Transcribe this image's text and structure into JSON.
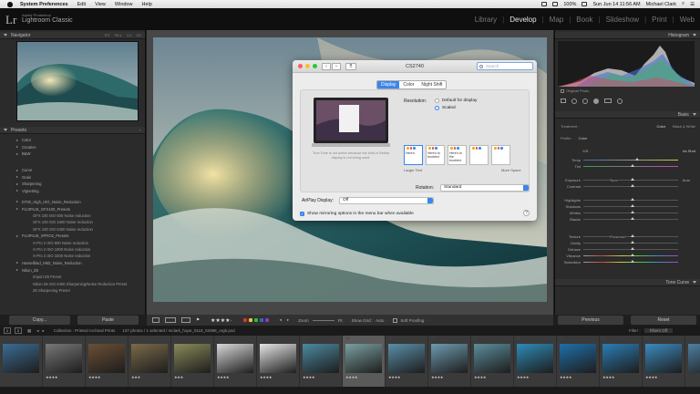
{
  "menubar": {
    "app": "System Preferences",
    "items": [
      "Edit",
      "View",
      "Window",
      "Help"
    ],
    "battery": "100%",
    "datetime": "Sun Jun 14  11:56 AM",
    "user": "Michael Clark"
  },
  "lr": {
    "logo": "Lr",
    "brand_top": "Adobe Photoshop",
    "brand_name": "Lightroom Classic",
    "modules": [
      "Library",
      "Develop",
      "Map",
      "Book",
      "Slideshow",
      "Print",
      "Web"
    ],
    "active_module": "Develop"
  },
  "left": {
    "navigator": "Navigator",
    "nav_zoom": [
      "FIT",
      "FILL",
      "1:1",
      "3:1"
    ],
    "presets": "Presets",
    "preset_groups": [
      "Color",
      "Creative",
      "B&W",
      "Curve",
      "Grain",
      "Sharpening",
      "Vignetting"
    ],
    "preset_items": [
      {
        "label": "D700_High_ISO_Noise_Reduction",
        "indent": false
      },
      {
        "label": "FUJIFILM_GFX100_Presets",
        "indent": false
      },
      {
        "label": "GFX 100 ISO 800 Noise reduction",
        "indent": true
      },
      {
        "label": "GFX 100 ISO 1600 Noise reduction",
        "indent": true
      },
      {
        "label": "GFX 100 ISO 6400 Noise reduction",
        "indent": true
      },
      {
        "label": "FUJIFILM_XPRO2_Presets",
        "indent": false
      },
      {
        "label": "X-Pro 2 ISO 800 Noise reduction",
        "indent": true
      },
      {
        "label": "X-Pro 2 ISO 1600 Noise reduction",
        "indent": true
      },
      {
        "label": "X-Pro 2 ISO 3200 Noise reduction",
        "indent": true
      },
      {
        "label": "Hasselblad_H5D_Noise_Reduction",
        "indent": false
      },
      {
        "label": "Nikon_Z6",
        "indent": false
      },
      {
        "label": "Import Z6 Preset",
        "indent": true
      },
      {
        "label": "Nikon Z6 ISO 6400 Sharpening/Noise Reduction Preset",
        "indent": true
      },
      {
        "label": "Z6 Sharpening Preset",
        "indent": true
      }
    ],
    "copy": "Copy...",
    "paste": "Paste"
  },
  "right": {
    "histogram": "Histogram",
    "original_photo": "Original Photo",
    "basic": "Basic",
    "treatment_label": "Treatment :",
    "treatment_color": "Color",
    "treatment_bw": "Black & White",
    "profile_label": "Profile :",
    "profile_value": "Color",
    "wb_label": "WB :",
    "wb_value": "As Shot",
    "tone": "Tone",
    "auto": "Auto",
    "presence": "Presence",
    "tone_curve": "Tone Curve",
    "previous": "Previous",
    "reset": "Reset",
    "sliders": [
      {
        "label": "Temp",
        "pos": 0.55
      },
      {
        "label": "Tint",
        "pos": 0.5
      },
      {
        "label": "Exposure",
        "pos": 0.5
      },
      {
        "label": "Contrast",
        "pos": 0.5
      },
      {
        "label": "Highlights",
        "pos": 0.5
      },
      {
        "label": "Shadows",
        "pos": 0.5
      },
      {
        "label": "Whites",
        "pos": 0.5
      },
      {
        "label": "Blacks",
        "pos": 0.5
      },
      {
        "label": "Texture",
        "pos": 0.5
      },
      {
        "label": "Clarity",
        "pos": 0.5
      },
      {
        "label": "Dehaze",
        "pos": 0.5
      },
      {
        "label": "Vibrance",
        "pos": 0.5
      },
      {
        "label": "Saturation",
        "pos": 0.5
      }
    ]
  },
  "toolbar": {
    "stars": "★★★★·",
    "zoom": "Zoom",
    "zoom_fit": "Fit",
    "show_grid": "Show Grid :",
    "grid_auto": "Auto",
    "soft_proofing": "Soft Proofing"
  },
  "filmstrip": {
    "collection": "Collection : Printed Archival Prints",
    "count": "137 photos / 1 selected / mclark_hope_0118_02998_orgb.psd",
    "filter": "Filter :",
    "filter_value": "Filters Off",
    "pages": [
      "1",
      "2"
    ],
    "cells": [
      {
        "num": "",
        "color": "#3b6c94",
        "stars": "",
        "sel": false
      },
      {
        "num": "",
        "color": "#787878",
        "stars": "★★★★",
        "sel": false
      },
      {
        "num": "",
        "color": "#6b4f36",
        "stars": "★★★★",
        "sel": false
      },
      {
        "num": "",
        "color": "#7c6a4a",
        "stars": "★★★",
        "sel": false
      },
      {
        "num": "",
        "color": "#8a8a5a",
        "stars": "★★★",
        "sel": false
      },
      {
        "num": "",
        "color": "#d8d8d8",
        "stars": "★★★★",
        "sel": false
      },
      {
        "num": "",
        "color": "#e5e5e5",
        "stars": "★★★★",
        "sel": false
      },
      {
        "num": "73",
        "color": "#4c8aa0",
        "stars": "★★★★",
        "sel": false
      },
      {
        "num": "74",
        "color": "#7ba0a0",
        "stars": "★★★★",
        "sel": true
      },
      {
        "num": "75",
        "color": "#5a8fa8",
        "stars": "★★★★",
        "sel": false
      },
      {
        "num": "76",
        "color": "#6d9bb0",
        "stars": "★★★★",
        "sel": false
      },
      {
        "num": "77",
        "color": "#5c8d9c",
        "stars": "★★★★",
        "sel": false
      },
      {
        "num": "78",
        "color": "#2f8bb8",
        "stars": "★★★★",
        "sel": false
      },
      {
        "num": "79",
        "color": "#1f6fa8",
        "stars": "★★★★",
        "sel": false
      },
      {
        "num": "80",
        "color": "#2b7db5",
        "stars": "★★★★",
        "sel": false
      },
      {
        "num": "81",
        "color": "#3c8bbf",
        "stars": "★★★★",
        "sel": false
      },
      {
        "num": "",
        "color": "#4e7fa0",
        "stars": "",
        "sel": false
      }
    ]
  },
  "dialog": {
    "title": "CS2740",
    "search_placeholder": "Search",
    "tabs": [
      "Display",
      "Color",
      "Night Shift"
    ],
    "active_tab": "Display",
    "resolution_label": "Resolution:",
    "res_default": "Default for display",
    "res_scaled": "Scaled",
    "note": "True Tone is not active because the built-in Retina display is not being used.",
    "scale_labels": [
      "Here's",
      "Here's to troubled",
      "Here's to the troubled",
      "",
      ""
    ],
    "larger_text": "Larger Text",
    "more_space": "More Space",
    "rotation_label": "Rotation:",
    "rotation_value": "Standard",
    "airplay_label": "AirPlay Display:",
    "airplay_value": "Off",
    "mirror_label": "Show mirroring options in the menu bar when available",
    "help": "?",
    "lights": [
      "#fc5f57",
      "#fdbc2e",
      "#27c840"
    ]
  }
}
